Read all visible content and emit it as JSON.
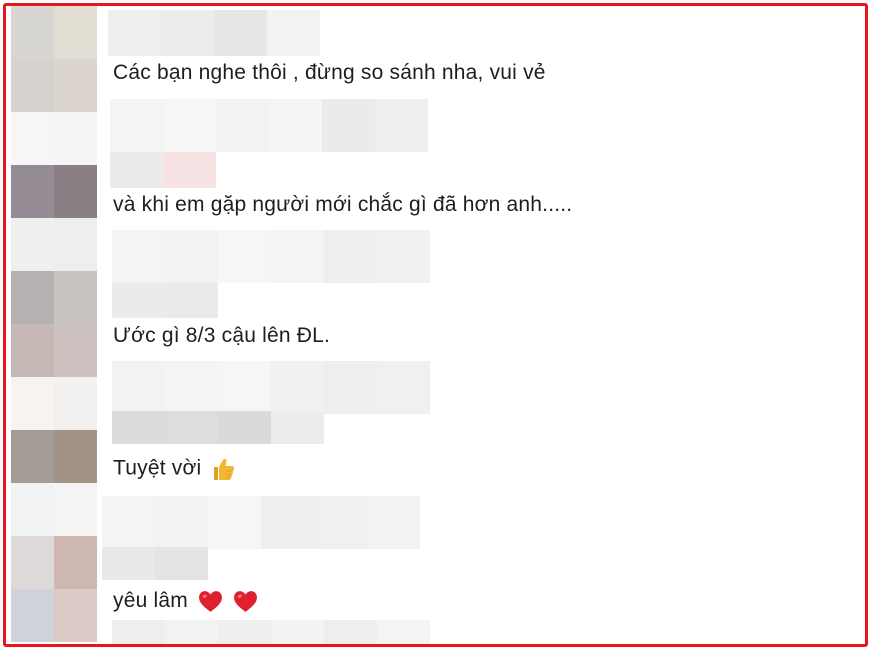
{
  "comments": [
    {
      "text": "Các bạn nghe thôi , đừng so sánh nha, vui vẻ",
      "emojis": []
    },
    {
      "text": "và khi em gặp người mới chắc gì đã hơn anh.....",
      "emojis": []
    },
    {
      "text": "Ước gì 8/3 cậu lên ĐL.",
      "emojis": []
    },
    {
      "text": "Tuyệt vời",
      "emojis": [
        "thumbs-up-icon"
      ]
    },
    {
      "text": "yêu lâm",
      "emojis": [
        "heart-icon",
        "heart-icon"
      ]
    }
  ],
  "colors": {
    "frame_border": "#e8141e",
    "text": "#1c1e21",
    "heart": "#e0202e",
    "thumb": "#f5b731"
  }
}
